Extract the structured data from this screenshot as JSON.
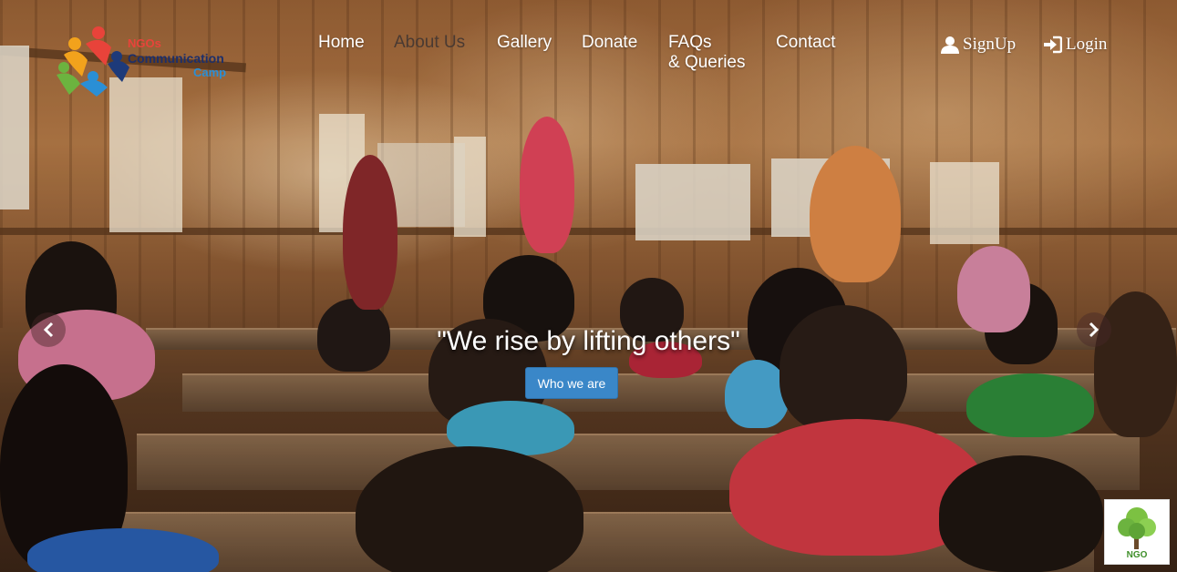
{
  "site": {
    "logo_text_1": "NGOs",
    "logo_text_2": "Communication",
    "logo_text_3": "Camp"
  },
  "nav": {
    "items": [
      {
        "label": "Home"
      },
      {
        "label": "About Us"
      },
      {
        "label": "Gallery"
      },
      {
        "label": "Donate"
      },
      {
        "label": "FAQs"
      },
      {
        "label": "& Queries"
      },
      {
        "label": "Contact"
      }
    ],
    "active": "About Us",
    "signup_label": "SignUp",
    "login_label": "Login"
  },
  "hero": {
    "caption": "\"We rise by lifting others\"",
    "cta_label": "Who we are",
    "prev_icon": "chevron-left-icon",
    "next_icon": "chevron-right-icon"
  },
  "badge": {
    "text": "NGO",
    "icon": "tree-icon"
  },
  "colors": {
    "cta": "#3a87c8",
    "nav_active": "#4a3a32"
  }
}
